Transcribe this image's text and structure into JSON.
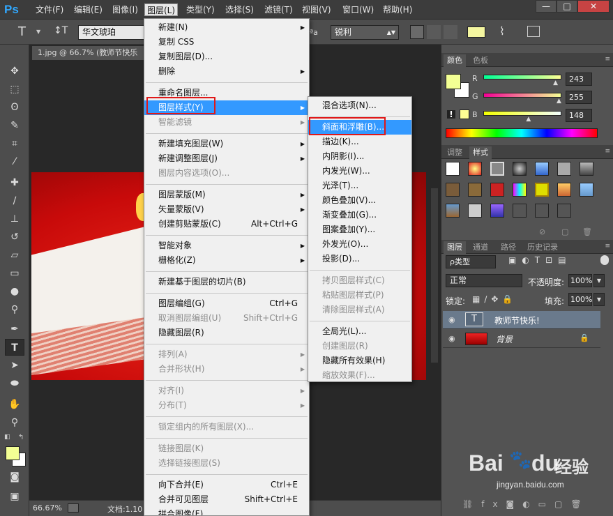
{
  "app": {
    "logo": "Ps"
  },
  "menubar": {
    "items": [
      "文件(F)",
      "编辑(E)",
      "图像(I)",
      "图层(L)",
      "类型(Y)",
      "选择(S)",
      "滤镜(T)",
      "视图(V)",
      "窗口(W)",
      "帮助(H)"
    ],
    "active": "图层(L)"
  },
  "window_controls": {
    "minimize": "—",
    "restore": "□",
    "close": "✕"
  },
  "options": {
    "tool_glyph": "T",
    "font_family": "华文琥珀",
    "aa_label": "ªa",
    "aa_value": "锐利",
    "text_color": "#f4f6a0"
  },
  "document": {
    "tab_title": "1.jpg @ 66.7% (教师节快乐"
  },
  "status": {
    "zoom": "66.67%",
    "doc_label": "文档:1.10"
  },
  "layer_menu": {
    "items": [
      {
        "label": "新建(N)",
        "submenu": true
      },
      {
        "label": "复制 CSS"
      },
      {
        "label": "复制图层(D)..."
      },
      {
        "label": "删除",
        "submenu": true
      },
      {
        "sep": true
      },
      {
        "label": "重命名图层..."
      },
      {
        "label": "图层样式(Y)",
        "submenu": true,
        "highlighted": true
      },
      {
        "label": "智能滤镜",
        "submenu": true,
        "disabled": true
      },
      {
        "sep": true
      },
      {
        "label": "新建填充图层(W)",
        "submenu": true
      },
      {
        "label": "新建调整图层(J)",
        "submenu": true
      },
      {
        "label": "图层内容选项(O)...",
        "disabled": true
      },
      {
        "sep": true
      },
      {
        "label": "图层蒙版(M)",
        "submenu": true
      },
      {
        "label": "矢量蒙版(V)",
        "submenu": true
      },
      {
        "label": "创建剪贴蒙版(C)",
        "shortcut": "Alt+Ctrl+G"
      },
      {
        "sep": true
      },
      {
        "label": "智能对象",
        "submenu": true
      },
      {
        "label": "栅格化(Z)",
        "submenu": true
      },
      {
        "sep": true
      },
      {
        "label": "新建基于图层的切片(B)"
      },
      {
        "sep": true
      },
      {
        "label": "图层编组(G)",
        "shortcut": "Ctrl+G"
      },
      {
        "label": "取消图层编组(U)",
        "shortcut": "Shift+Ctrl+G",
        "disabled": true
      },
      {
        "label": "隐藏图层(R)"
      },
      {
        "sep": true
      },
      {
        "label": "排列(A)",
        "submenu": true,
        "disabled": true
      },
      {
        "label": "合并形状(H)",
        "submenu": true,
        "disabled": true
      },
      {
        "sep": true
      },
      {
        "label": "对齐(I)",
        "submenu": true,
        "disabled": true
      },
      {
        "label": "分布(T)",
        "submenu": true,
        "disabled": true
      },
      {
        "sep": true
      },
      {
        "label": "锁定组内的所有图层(X)...",
        "disabled": true
      },
      {
        "sep": true
      },
      {
        "label": "链接图层(K)",
        "disabled": true
      },
      {
        "label": "选择链接图层(S)",
        "disabled": true
      },
      {
        "sep": true
      },
      {
        "label": "向下合并(E)",
        "shortcut": "Ctrl+E"
      },
      {
        "label": "合并可见图层",
        "shortcut": "Shift+Ctrl+E"
      },
      {
        "label": "拼合图像(F)"
      }
    ]
  },
  "style_menu": {
    "items": [
      {
        "label": "混合选项(N)..."
      },
      {
        "sep": true
      },
      {
        "label": "斜面和浮雕(B)...",
        "highlighted": true
      },
      {
        "label": "描边(K)..."
      },
      {
        "label": "内阴影(I)..."
      },
      {
        "label": "内发光(W)..."
      },
      {
        "label": "光泽(T)..."
      },
      {
        "label": "颜色叠加(V)..."
      },
      {
        "label": "渐变叠加(G)..."
      },
      {
        "label": "图案叠加(Y)..."
      },
      {
        "label": "外发光(O)..."
      },
      {
        "label": "投影(D)..."
      },
      {
        "sep": true
      },
      {
        "label": "拷贝图层样式(C)",
        "disabled": true
      },
      {
        "label": "粘贴图层样式(P)",
        "disabled": true
      },
      {
        "label": "清除图层样式(A)",
        "disabled": true
      },
      {
        "sep": true
      },
      {
        "label": "全局光(L)..."
      },
      {
        "label": "创建图层(R)",
        "disabled": true
      },
      {
        "label": "隐藏所有效果(H)"
      },
      {
        "label": "缩放效果(F)...",
        "disabled": true
      }
    ]
  },
  "color_panel": {
    "tabs": [
      "颜色",
      "色板"
    ],
    "r": "243",
    "g": "255",
    "b": "148",
    "r_label": "R",
    "g_label": "G",
    "b_label": "B",
    "r_level": 0.953,
    "g_level": 1.0,
    "b_level": 0.58,
    "fg_color": "#f3ff94"
  },
  "styles_panel": {
    "tabs": [
      "调整",
      "样式"
    ]
  },
  "layers_panel": {
    "tabs": [
      "图层",
      "通道",
      "路径",
      "历史记录"
    ],
    "filter_label": "ρ类型",
    "blend_mode": "正常",
    "opacity_label": "不透明度:",
    "opacity": "100%",
    "lock_label": "锁定:",
    "fill_label": "填充:",
    "fill": "100%",
    "layers": [
      {
        "name": "教师节快乐!",
        "type": "text",
        "thumb": "T",
        "selected": true
      },
      {
        "name": "背景",
        "type": "image",
        "locked": true
      }
    ]
  },
  "watermark": {
    "brand": "Bai",
    "brand_suffix": "du",
    "jingyan": "经验",
    "url": "jingyan.baidu.com"
  }
}
